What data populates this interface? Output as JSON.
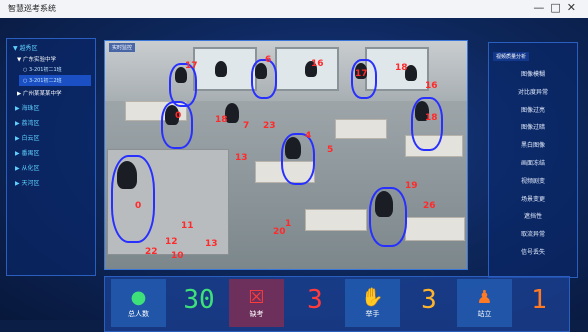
{
  "window": {
    "title": "智慧巡考系统",
    "controls": [
      "—",
      "□",
      "✕"
    ]
  },
  "sidebar": {
    "root": "▼ 越秀区",
    "school": "▼ 广东实验中学",
    "rooms": [
      {
        "label": "○ 3-201初二1班",
        "selected": false
      },
      {
        "label": "○ 3-201初二2班",
        "selected": true
      }
    ],
    "other_school": "▶ 广州某某某中学",
    "regions": [
      "▶ 海珠区",
      "▶ 荔湾区",
      "▶ 白云区",
      "▶ 番禺区",
      "▶ 从化区",
      "▶ 天河区"
    ]
  },
  "video": {
    "tag": "实时监控",
    "overlay_numbers": [
      "17",
      "6",
      "16",
      "17",
      "18",
      "16",
      "0",
      "18",
      "7",
      "4",
      "5",
      "23",
      "13",
      "18",
      "19",
      "26",
      "0",
      "11",
      "12",
      "10",
      "22",
      "13",
      "1",
      "20"
    ]
  },
  "analysis_panel": {
    "header": "视频质量分析",
    "items": [
      "图像模糊",
      "对比度异常",
      "图像过亮",
      "图像过暗",
      "黑白图像",
      "画面冻结",
      "视频剧变",
      "场景变更",
      "遮挡性",
      "取流异常",
      "信号丢失"
    ]
  },
  "stats": [
    {
      "label": "总人数",
      "value": "30",
      "icon": "person-icon",
      "color": "#3ee07a"
    },
    {
      "label": "缺考",
      "value": "3",
      "icon": "calendar-x-icon",
      "color": "#ff3b3b"
    },
    {
      "label": "举手",
      "value": "3",
      "icon": "raised-hand-icon",
      "color": "#ffb42a"
    },
    {
      "label": "站立",
      "value": "1",
      "icon": "standing-person-icon",
      "color": "#ff7a22"
    }
  ]
}
